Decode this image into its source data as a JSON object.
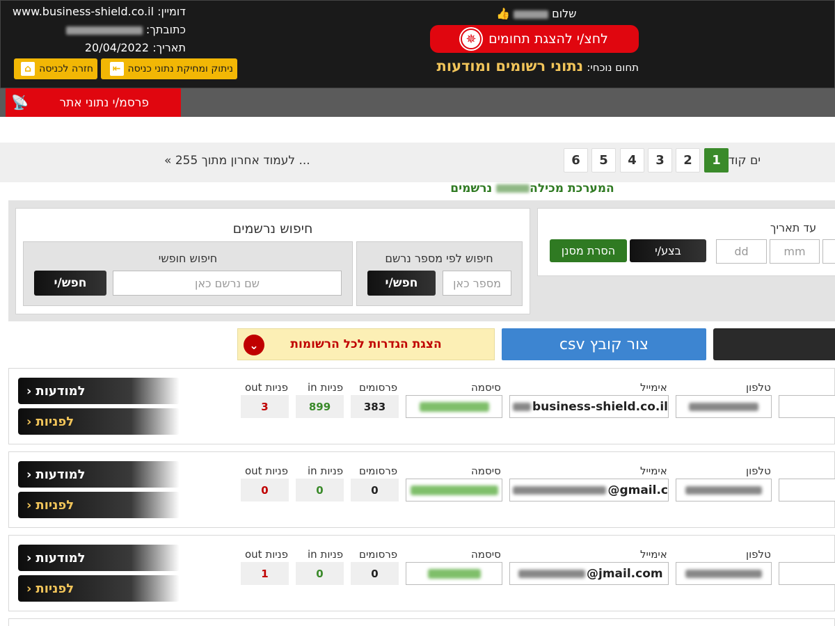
{
  "header": {
    "domain_label": "דומיין:",
    "domain_value": "www.business-shield.co.il",
    "address_label": "כתובתך:",
    "date_label": "תאריך:",
    "date_value": "20/04/2022",
    "greeting": "שלום",
    "show_areas_button": "לחצ/י להצגת תחומים",
    "current_area_label": "תחום נוכחי:",
    "current_area_value": "נתוני רשומים ומודעות",
    "delete_entry_button": "ניתוק ומחיקת נתוני כניסה",
    "back_to_entry_button": "חזרה לכניסה"
  },
  "nav": {
    "publish_button": "פרסמ/י נתוני אתר"
  },
  "pagination": {
    "previous_label": "ים קודמים",
    "pages": [
      "1",
      "2",
      "3",
      "4",
      "5",
      "6"
    ],
    "active_page": "1",
    "last_page_link": "... לעמוד אחרון מתוך 255 »"
  },
  "system_info": {
    "prefix": "המערכת מכילה",
    "suffix": "נרשמים"
  },
  "search_panel": {
    "title": "חיפוש נרשמים",
    "free_search_label": "חיפוש חופשי",
    "free_search_placeholder": "שם נרשם כאן",
    "free_search_button": "חפש/י",
    "number_search_label": "חיפוש לפי מספר נרשם",
    "number_search_placeholder": "מספר כאן",
    "number_search_button": "חפש/י"
  },
  "date_filter": {
    "until_label": "עד תאריך",
    "dd_placeholder": "dd",
    "mm_placeholder": "mm",
    "apply_button": "בצע/י",
    "remove_filter_button": "הסרת מסנן"
  },
  "actions": {
    "show_settings_button": "הצגת הגדרות לכל הרשומות",
    "csv_button": "צור קובץ csv"
  },
  "columns": {
    "phone": "טלפון",
    "email": "אימייל",
    "password": "סיסמה",
    "ads": "פרסומים",
    "in": "פניות in",
    "out": "פניות out"
  },
  "rows": [
    {
      "email_visible": "business-shield.co.il",
      "ads": "383",
      "in": "899",
      "out": "3",
      "ads_button": "למודעות",
      "inquiries_button": "לפניות"
    },
    {
      "email_visible": "@gmail.c",
      "ads": "0",
      "in": "0",
      "out": "0",
      "ads_button": "למודעות",
      "inquiries_button": "לפניות"
    },
    {
      "email_visible": "@jmail.com",
      "ads": "0",
      "in": "0",
      "out": "1",
      "ads_button": "למודעות",
      "inquiries_button": "לפניות"
    }
  ],
  "colors": {
    "header_bg": "#1a1a1a",
    "accent_red": "#e0060f",
    "accent_yellow": "#f2b705",
    "active_green": "#3a8a2a",
    "csv_blue": "#3d85d1",
    "in_green": "#3a8a2a",
    "out_red": "#c00000"
  }
}
